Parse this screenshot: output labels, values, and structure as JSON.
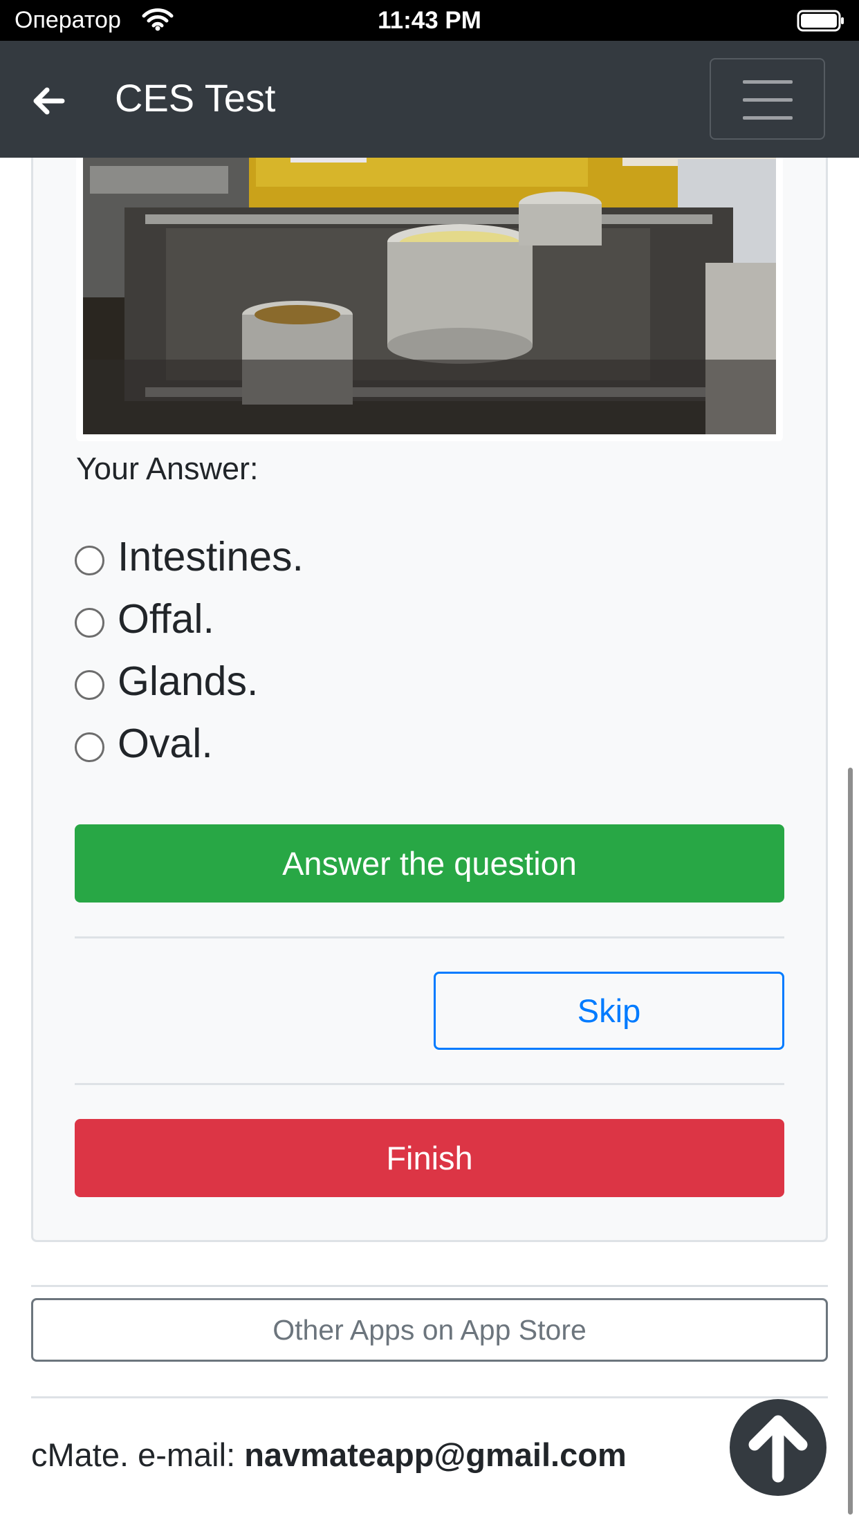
{
  "status_bar": {
    "carrier": "Оператор",
    "time": "11:43 PM"
  },
  "navbar": {
    "title": "CES Test"
  },
  "question": {
    "image_alt": "commercial kitchen stove with pots",
    "answer_label": "Your Answer:",
    "options": [
      "Intestines.",
      "Offal.",
      "Glands.",
      "Oval."
    ]
  },
  "actions": {
    "answer": "Answer the question",
    "skip": "Skip",
    "finish": "Finish"
  },
  "other_apps": "Other Apps on App Store",
  "footer": {
    "prefix": "cMate. e-mail: ",
    "email": "navmateapp@gmail.com"
  },
  "colors": {
    "navbar": "#343a40",
    "success": "#28a745",
    "primary": "#007bff",
    "danger": "#dc3545",
    "secondary": "#6c757d"
  },
  "icons": {
    "back": "arrow-left-icon",
    "menu": "hamburger-icon",
    "scroll_top": "arrow-up-icon"
  }
}
